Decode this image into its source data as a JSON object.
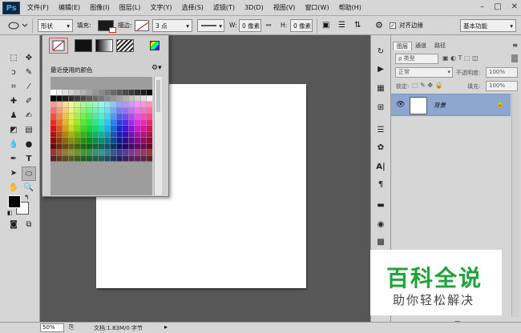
{
  "app": {
    "logo": "Ps"
  },
  "menu": {
    "items": [
      "文件(F)",
      "编辑(E)",
      "图像(I)",
      "图层(L)",
      "文字(Y)",
      "选择(S)",
      "滤镜(T)",
      "3D(D)",
      "视图(V)",
      "窗口(W)",
      "帮助(H)"
    ]
  },
  "window_controls": {
    "minimize": "–",
    "restore": "□",
    "close": "✕"
  },
  "options_bar": {
    "shape_mode": "形状",
    "fill_label": "填充:",
    "stroke_label": "描边:",
    "stroke_size": "3 点",
    "w_label": "W:",
    "w_value": "0 像素",
    "h_label": "H:",
    "h_value": "0 像素",
    "align_edges_label": "对齐边缘",
    "workspace": "基本功能"
  },
  "color_popup": {
    "recent_label": "最近使用的颜色",
    "recent_colors": [
      "#000000",
      "#ffffff",
      "#1d1d1d",
      "#3f3f3f",
      "#c8c8c8",
      "#0a0a3c",
      "#e61e1e",
      "#f06e1e",
      "#e6321e",
      "#c81e3c",
      "#c83c78",
      "#dc1e50",
      "#c8c8c8",
      "#e63c3c",
      "#ff8a8a",
      "#b01e1e",
      "#d24664"
    ]
  },
  "layers_panel": {
    "tabs": [
      "图层",
      "通道",
      "路径"
    ],
    "filter_label": "ρ 类型",
    "blend_mode": "正常",
    "opacity_label": "不透明度:",
    "opacity_value": "100%",
    "lock_label": "锁定:",
    "fill_label": "填充:",
    "fill_value": "100%",
    "layer_name": "背景"
  },
  "status_bar": {
    "zoom": "50%",
    "doc_info": "文档:1.83M/0 字节"
  },
  "watermark": {
    "title": "百科全说",
    "subtitle": "助你轻松解决"
  },
  "colors": {
    "ui_gray": "#d6d6d6",
    "workspace": "#575757",
    "selected_layer": "#8da7d1",
    "watermark_green": "#1fa33a",
    "no_fill_red": "#e02020"
  }
}
